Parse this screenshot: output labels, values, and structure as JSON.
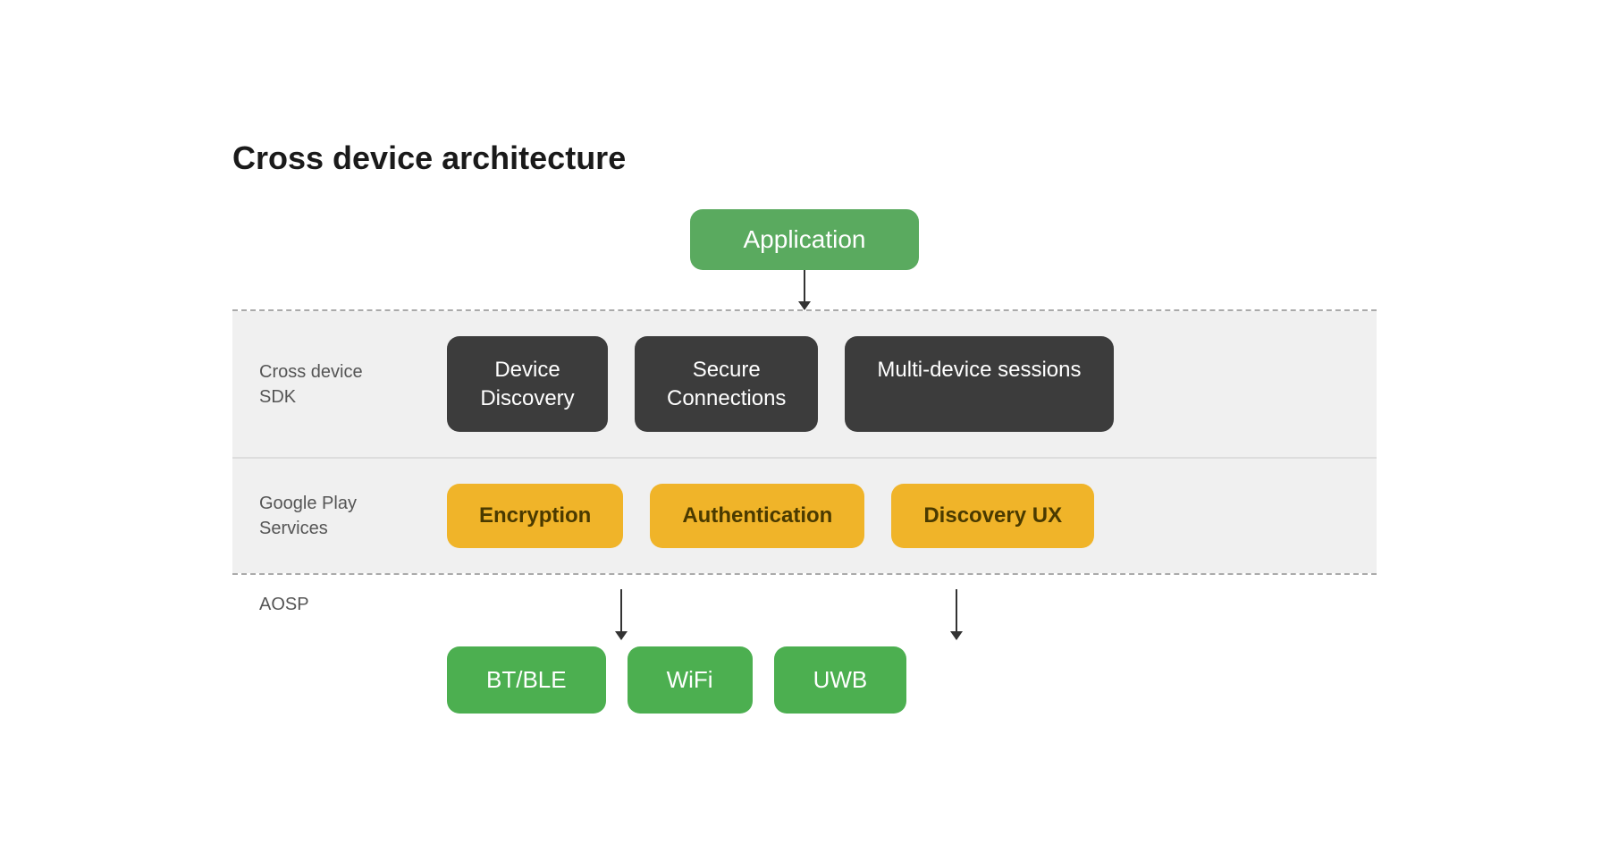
{
  "title": "Cross device architecture",
  "application": {
    "label": "Application"
  },
  "sdk": {
    "band_label": "Cross device\nSDK",
    "items": [
      {
        "label": "Device\nDiscovery"
      },
      {
        "label": "Secure\nConnections"
      },
      {
        "label": "Multi-device sessions"
      }
    ]
  },
  "google_play": {
    "band_label": "Google Play\nServices",
    "items": [
      {
        "label": "Encryption"
      },
      {
        "label": "Authentication"
      },
      {
        "label": "Discovery UX"
      }
    ]
  },
  "aosp": {
    "label": "AOSP"
  },
  "transport": {
    "items": [
      {
        "label": "BT/BLE"
      },
      {
        "label": "WiFi"
      },
      {
        "label": "UWB"
      }
    ]
  }
}
